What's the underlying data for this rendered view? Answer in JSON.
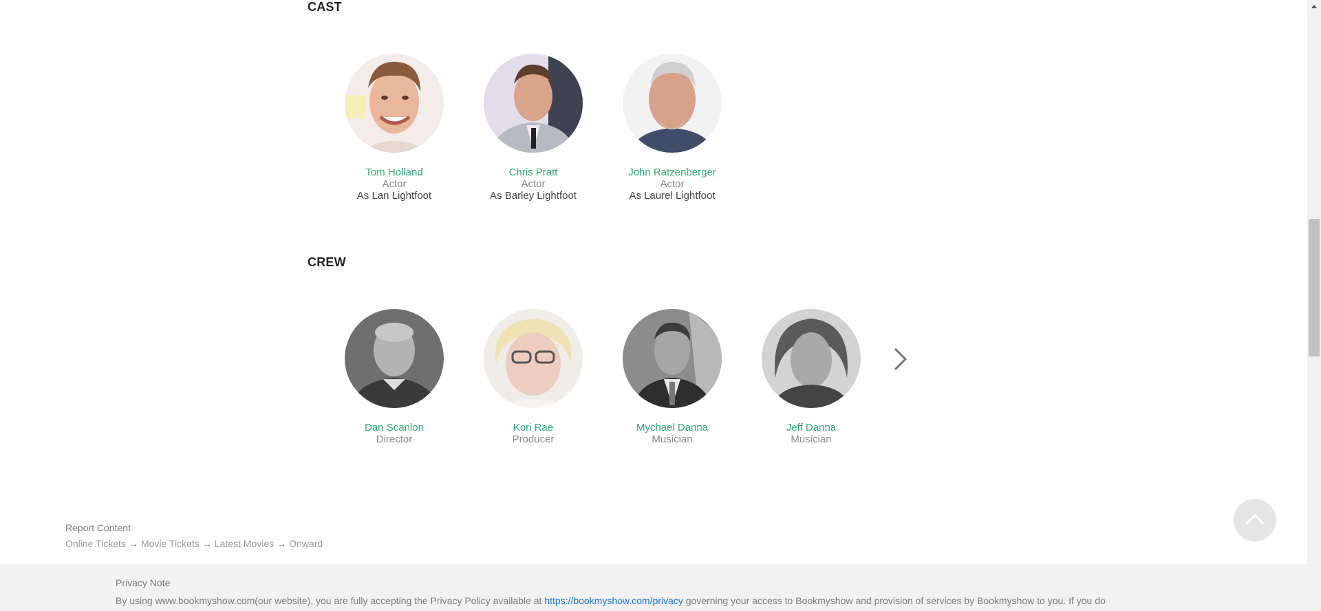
{
  "cast": {
    "title": "CAST",
    "people": [
      {
        "name": "Tom Holland",
        "role": "Actor",
        "character": "As Lan Lightfoot"
      },
      {
        "name": "Chris Pratt",
        "role": "Actor",
        "character": "As Barley Lightfoot"
      },
      {
        "name": "John Ratzenberger",
        "role": "Actor",
        "character": "As Laurel Lightfoot"
      }
    ]
  },
  "crew": {
    "title": "CREW",
    "people": [
      {
        "name": "Dan Scanlon",
        "role": "Director"
      },
      {
        "name": "Kori Rae",
        "role": "Producer"
      },
      {
        "name": "Mychael Danna",
        "role": "Musician"
      },
      {
        "name": "Jeff Danna",
        "role": "Musician"
      }
    ]
  },
  "footer": {
    "report": "Report Content",
    "breadcrumb": [
      "Online Tickets",
      "Movie Tickets",
      "Latest Movies",
      "Onward"
    ],
    "breadcrumb_separator": "→"
  },
  "privacy": {
    "title": "Privacy Note",
    "text_before": "By using www.bookmyshow.com(our website), you are fully accepting the Privacy Policy available at ",
    "link": "https://bookmyshow.com/privacy",
    "text_after": " governing your access to Bookmyshow and provision of services by Bookmyshow to you. If you do"
  },
  "icons": {
    "next": "chevron-right-icon",
    "back_to_top": "chevron-up-icon",
    "scroll_up": "scroll-up-arrow-icon"
  },
  "colors": {
    "name_green": "#2dac78",
    "link_blue": "#1a73d6",
    "footer_bg": "#f2f2f2"
  }
}
